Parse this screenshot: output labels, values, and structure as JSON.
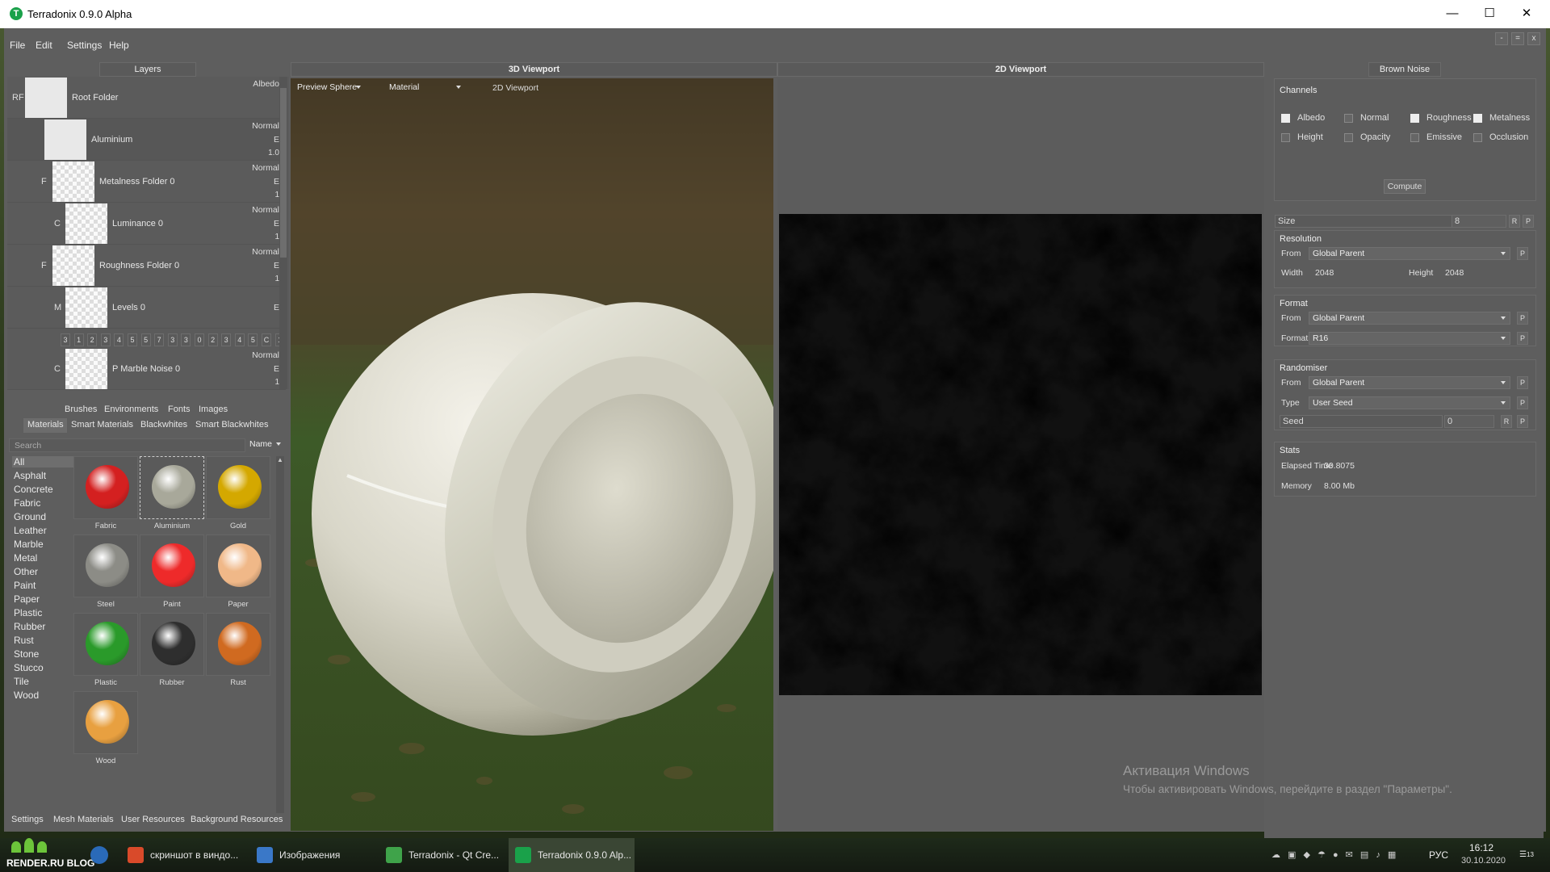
{
  "window": {
    "title": "Terradonix 0.9.0 Alpha",
    "icon_letter": "T",
    "controls": [
      "—",
      "☐",
      "✕"
    ]
  },
  "menu": {
    "items": [
      "File",
      "Edit",
      "Settings",
      "Help"
    ],
    "mini_buttons": [
      "-",
      "=",
      "x"
    ]
  },
  "layers": {
    "header": "Layers",
    "rows": [
      {
        "prefix": "RF",
        "name": "Root Folder",
        "type": "Albedo",
        "flag": "",
        "value": "",
        "thumb": "white"
      },
      {
        "prefix": "",
        "name": "Aluminium",
        "type": "Normal",
        "flag": "E",
        "value": "1.0",
        "thumb": "white"
      },
      {
        "prefix": "F",
        "name": "Metalness Folder 0",
        "type": "Normal",
        "flag": "E",
        "value": "1",
        "thumb": "checker"
      },
      {
        "prefix": "C",
        "name": "Luminance 0",
        "type": "Normal",
        "flag": "E",
        "value": "1",
        "thumb": "checker"
      },
      {
        "prefix": "F",
        "name": "Roughness Folder 0",
        "type": "Normal",
        "flag": "E",
        "value": "1",
        "thumb": "checker"
      },
      {
        "prefix": "M",
        "name": "Levels 0",
        "type": "",
        "flag": "E",
        "value": "",
        "thumb": "checker"
      },
      {
        "prefix": "C",
        "name": "P Marble Noise 0",
        "type": "Normal",
        "flag": "E",
        "value": "1",
        "thumb": "checker"
      }
    ],
    "number_buttons": [
      "3",
      "1",
      "2",
      "3",
      "4",
      "5",
      "5",
      "7",
      "3",
      "3",
      "0",
      "2",
      "3",
      "4",
      "5",
      "C",
      "1"
    ]
  },
  "library": {
    "tabs_row1": [
      "Brushes",
      "Environments",
      "Fonts",
      "Images"
    ],
    "tabs_row2": [
      "Materials",
      "Smart Materials",
      "Blackwhites",
      "Smart Blackwhites"
    ],
    "active_tab": "Materials",
    "search_placeholder": "Search",
    "sort_label": "Name",
    "categories": [
      "All",
      "Asphalt",
      "Concrete",
      "Fabric",
      "Ground",
      "Leather",
      "Marble",
      "Metal",
      "Other",
      "Paint",
      "Paper",
      "Plastic",
      "Rubber",
      "Rust",
      "Stone",
      "Stucco",
      "Tile",
      "Wood"
    ],
    "selected_category": "All",
    "materials": [
      {
        "name": "Fabric",
        "color": "#d42020"
      },
      {
        "name": "Aluminium",
        "color": "#a8a89a"
      },
      {
        "name": "Gold",
        "color": "#d4a800"
      },
      {
        "name": "Steel",
        "color": "#8c8c86"
      },
      {
        "name": "Paint",
        "color": "#ee2a2a"
      },
      {
        "name": "Paper",
        "color": "#f0b888"
      },
      {
        "name": "Plastic",
        "color": "#2a9a2a"
      },
      {
        "name": "Rubber",
        "color": "#2e2e2e"
      },
      {
        "name": "Rust",
        "color": "#d06a20"
      },
      {
        "name": "Wood",
        "color": "#e8a040"
      }
    ],
    "selected_material": "Aluminium"
  },
  "bottom_tabs": [
    "Settings",
    "Mesh Materials",
    "User Resources",
    "Background Resources"
  ],
  "viewport3d": {
    "header": "3D Viewport",
    "preview": "Preview Sphere",
    "material": "Material",
    "tab_2d": "2D Viewport"
  },
  "viewport2d": {
    "header": "2D Viewport"
  },
  "properties": {
    "header": "Brown Noise",
    "channels_label": "Channels",
    "channels": [
      {
        "label": "Albedo",
        "checked": true
      },
      {
        "label": "Normal",
        "checked": false
      },
      {
        "label": "Roughness",
        "checked": true
      },
      {
        "label": "Metalness",
        "checked": true
      },
      {
        "label": "Height",
        "checked": false
      },
      {
        "label": "Opacity",
        "checked": false
      },
      {
        "label": "Emissive",
        "checked": false
      },
      {
        "label": "Occlusion",
        "checked": false
      }
    ],
    "compute": "Compute",
    "size": {
      "label": "Size",
      "value": "8",
      "btn_r": "R",
      "btn_p": "P"
    },
    "resolution": {
      "label": "Resolution",
      "from_label": "From",
      "from": "Global Parent",
      "width_label": "Width",
      "width": "2048",
      "height_label": "Height",
      "height": "2048"
    },
    "format": {
      "label": "Format",
      "from_label": "From",
      "from": "Global Parent",
      "format_label": "Format",
      "format": "R16"
    },
    "randomiser": {
      "label": "Randomiser",
      "from_label": "From",
      "from": "Global Parent",
      "type_label": "Type",
      "type": "User Seed",
      "seed_label": "Seed",
      "seed": "0"
    },
    "stats": {
      "label": "Stats",
      "elapsed_label": "Elapsed Time",
      "elapsed": "30.8075",
      "memory_label": "Memory",
      "memory": "8.00 Mb"
    }
  },
  "watermark": {
    "title": "Активация Windows",
    "text": "Чтобы активировать Windows, перейдите в раздел \"Параметры\"."
  },
  "taskbar": {
    "items": [
      {
        "label": "скриншот в виндо...",
        "color": "#d94a2a"
      },
      {
        "label": "Изображения",
        "color": "#3a78c8"
      },
      {
        "label": "Terradonix - Qt Cre...",
        "color": "#3fa34a"
      },
      {
        "label": "Terradonix 0.9.0 Alp...",
        "color": "#1aa14a"
      }
    ],
    "logo": "RENDER.RU BLOG",
    "lang": "РУС",
    "time": "16:12",
    "date": "30.10.2020",
    "notif": "13"
  }
}
